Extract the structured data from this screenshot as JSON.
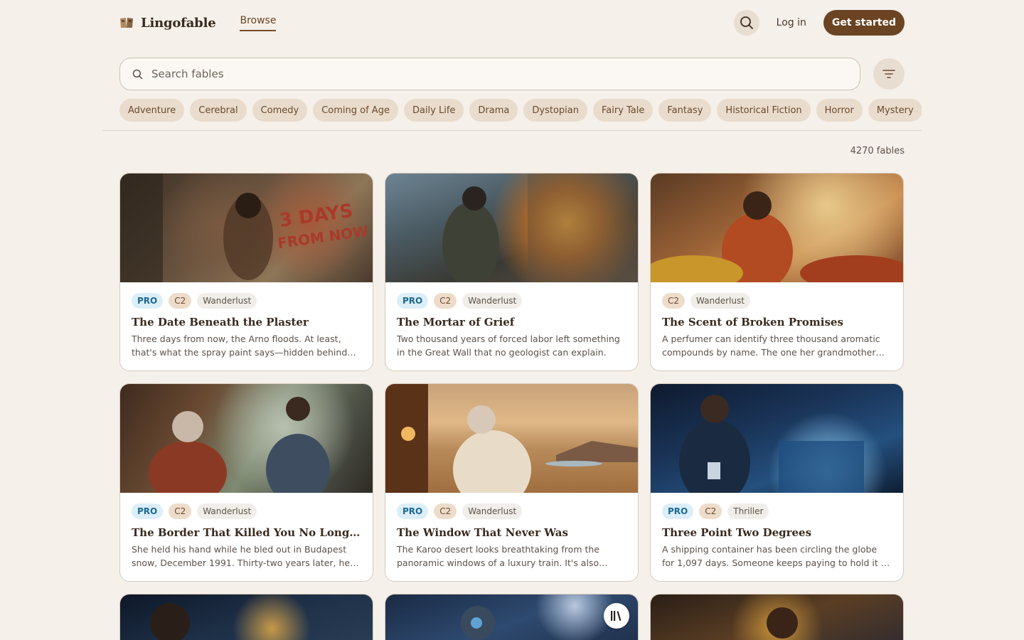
{
  "header": {
    "logo_text": "Lingofable",
    "logo_icon": "book-icon",
    "nav_browse": "Browse",
    "login": "Log in",
    "get_started": "Get started"
  },
  "search": {
    "placeholder": "Search fables"
  },
  "genres": [
    "Adventure",
    "Cerebral",
    "Comedy",
    "Coming of Age",
    "Daily Life",
    "Drama",
    "Dystopian",
    "Fairy Tale",
    "Fantasy",
    "Historical Fiction",
    "Horror",
    "Mystery"
  ],
  "count_text": "4270 fables",
  "cards": [
    {
      "pro": "PRO",
      "level": "C2",
      "genre": "Wanderlust",
      "title": "The Date Beneath the Plaster",
      "desc": "Three days from now, the Arno floods. At least, that's what the spray paint says—hidden behind centuries of plaster on a wall in Florence."
    },
    {
      "pro": "PRO",
      "level": "C2",
      "genre": "Wanderlust",
      "title": "The Mortar of Grief",
      "desc": "Two thousand years of forced labor left something in the Great Wall that no geologist can explain."
    },
    {
      "pro": "",
      "level": "C2",
      "genre": "Wanderlust",
      "title": "The Scent of Broken Promises",
      "desc": "A perfumer can identify three thousand aromatic compounds by name. The one her grandmother left behind has no name at all."
    },
    {
      "pro": "PRO",
      "level": "C2",
      "genre": "Wanderlust",
      "title": "The Border That Killed You No Longer Exists",
      "desc": "She held his hand while he bled out in Budapest snow, December 1991. Thirty-two years later, he sits across from her on a train."
    },
    {
      "pro": "PRO",
      "level": "C2",
      "genre": "Wanderlust",
      "title": "The Window That Never Was",
      "desc": "The Karoo desert looks breathtaking from the panoramic windows of a luxury train. It's also impossible."
    },
    {
      "pro": "PRO",
      "level": "C2",
      "genre": "Thriller",
      "title": "Three Point Two Degrees",
      "desc": "A shipping container has been circling the globe for 1,097 days. Someone keeps paying to hold it in transit."
    }
  ],
  "library_icon": "library-icon"
}
